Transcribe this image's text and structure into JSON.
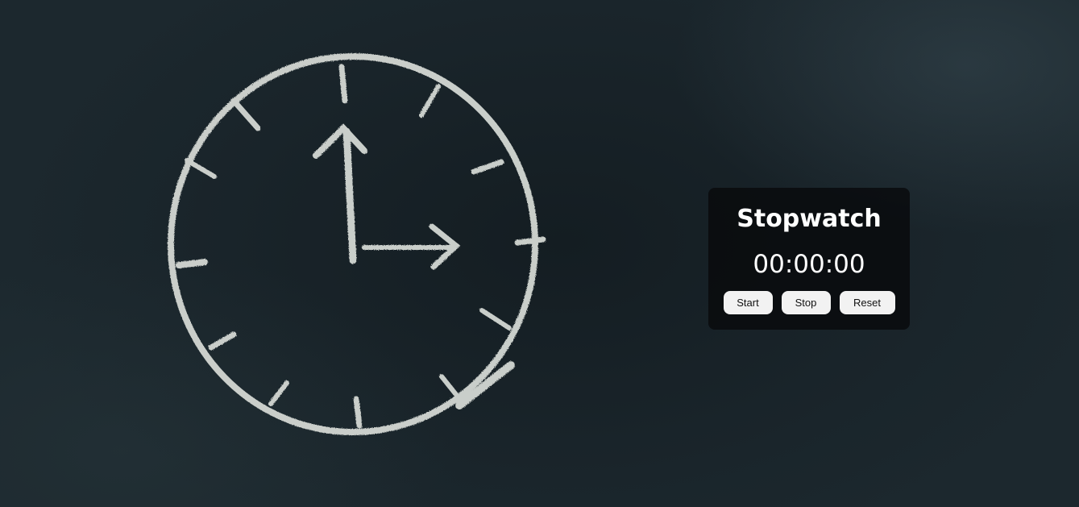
{
  "background": {
    "image": "chalkboard-clock"
  },
  "stopwatch": {
    "title": "Stopwatch",
    "time": "00:00:00",
    "buttons": {
      "start": "Start",
      "stop": "Stop",
      "reset": "Reset"
    }
  }
}
